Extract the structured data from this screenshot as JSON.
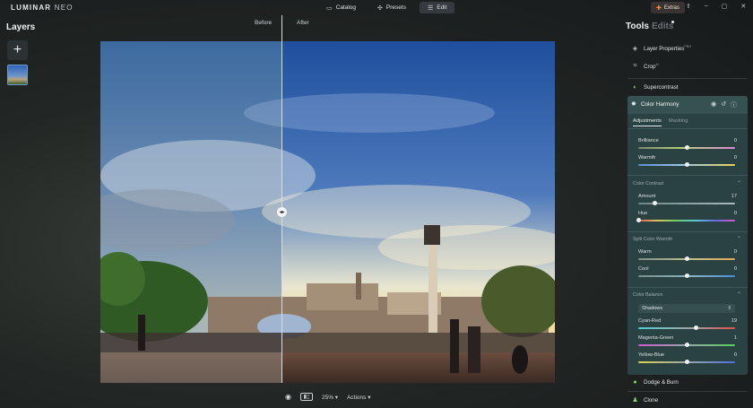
{
  "app": {
    "name": "LUMINAR",
    "name_suffix": "NEO"
  },
  "nav": {
    "tabs": [
      {
        "label": "Catalog",
        "icon": "folder-icon"
      },
      {
        "label": "Presets",
        "icon": "presets-icon"
      },
      {
        "label": "Edit",
        "icon": "sliders-icon",
        "active": true
      }
    ]
  },
  "extras": {
    "label": "Extras",
    "icon": "extras-icon"
  },
  "layers": {
    "title": "Layers",
    "add_label": "+"
  },
  "canvas": {
    "before_label": "Before",
    "after_label": "After",
    "zoom": "25%",
    "actions_label": "Actions"
  },
  "tools": {
    "title": "Tools",
    "edits_title": "Edits",
    "items_top": [
      {
        "label": "Layer Properties",
        "badge": "PRO",
        "icon": "layers-icon"
      },
      {
        "label": "Crop",
        "badge": "AI",
        "icon": "crop-icon"
      },
      {
        "label": "Supercontrast",
        "icon": "contrast-icon"
      }
    ],
    "color_harmony": {
      "title": "Color Harmony",
      "tabs": [
        "Adjustments",
        "Masking"
      ],
      "sliders_main": [
        {
          "label": "Brilliance",
          "value": "0",
          "level": 0.5
        },
        {
          "label": "Warmth",
          "value": "0",
          "level": 0.5
        }
      ],
      "sections": [
        {
          "title": "Color Contrast",
          "sliders": [
            {
              "label": "Amount",
              "value": "17",
              "level": 0.17
            },
            {
              "label": "Hue",
              "value": "0",
              "level": 0.0
            }
          ]
        },
        {
          "title": "Split Color Warmth",
          "sliders": [
            {
              "label": "Warm",
              "value": "0",
              "level": 0.5
            },
            {
              "label": "Cool",
              "value": "0",
              "level": 0.5
            }
          ]
        },
        {
          "title": "Color Balance",
          "select_value": "Shadows",
          "sliders": [
            {
              "label": "Cyan-Red",
              "value": "19",
              "level": 0.595
            },
            {
              "label": "Magenta-Green",
              "value": "1",
              "level": 0.505
            },
            {
              "label": "Yellow-Blue",
              "value": "0",
              "level": 0.5
            }
          ]
        }
      ]
    },
    "items_bottom": [
      {
        "label": "Dodge & Burn",
        "icon": "drop-icon"
      },
      {
        "label": "Clone",
        "icon": "stamp-icon"
      }
    ]
  },
  "colors": {
    "accent": "#ff8a3d",
    "panel": "#2a4241",
    "panel_header": "#355250"
  }
}
